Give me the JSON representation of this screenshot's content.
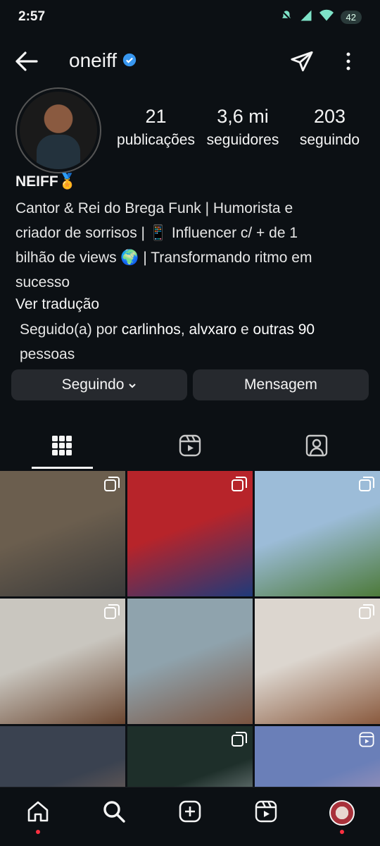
{
  "status_bar": {
    "time": "2:57",
    "battery": "42"
  },
  "header": {
    "username": "oneiff"
  },
  "stats": [
    {
      "value": "21",
      "label": "publicações"
    },
    {
      "value": "3,6 mi",
      "label": "seguidores"
    },
    {
      "value": "203",
      "label": "seguindo"
    }
  ],
  "bio": {
    "name": "NEIFF🏅",
    "lines": [
      "Cantor & Rei do Brega Funk | Humorista e",
      "criador de sorrisos | 📱 Influencer c/ + de 1",
      "bilhão de views 🌍 | Transformando ritmo em",
      "sucesso"
    ],
    "translate": "Ver tradução"
  },
  "followed_by": {
    "prefix": "Seguido(a) por ",
    "user1": "carlinhos",
    "sep": ", ",
    "user2": "alvxaro",
    "mid": " e ",
    "others": "outras 90",
    "suffix": "pessoas"
  },
  "buttons": {
    "following": "Seguindo",
    "message": "Mensagem"
  },
  "colors": {
    "background": "#0c1014",
    "verified": "#3897f0",
    "button": "#26292e",
    "notification": "#ff3040"
  },
  "grid_posts": [
    {
      "type": "carousel",
      "colors": [
        "#6b5e4e",
        "#3a3a3a"
      ]
    },
    {
      "type": "carousel",
      "colors": [
        "#b7242a",
        "#1f3a7a"
      ]
    },
    {
      "type": "carousel",
      "colors": [
        "#9cbcd8",
        "#4d7a3a"
      ]
    },
    {
      "type": "carousel",
      "colors": [
        "#c9c6bf",
        "#6a4630"
      ]
    },
    {
      "type": "none",
      "colors": [
        "#8fa3ad",
        "#7a5440"
      ]
    },
    {
      "type": "carousel",
      "colors": [
        "#dcd6cf",
        "#8a5a3e"
      ]
    },
    {
      "type": "none",
      "colors": [
        "#3a4250",
        "#a07a60"
      ]
    },
    {
      "type": "carousel",
      "colors": [
        "#1e2f2a",
        "#cfd6dc"
      ]
    },
    {
      "type": "reel",
      "colors": [
        "#6a7fb8",
        "#d8a8b8"
      ]
    }
  ]
}
